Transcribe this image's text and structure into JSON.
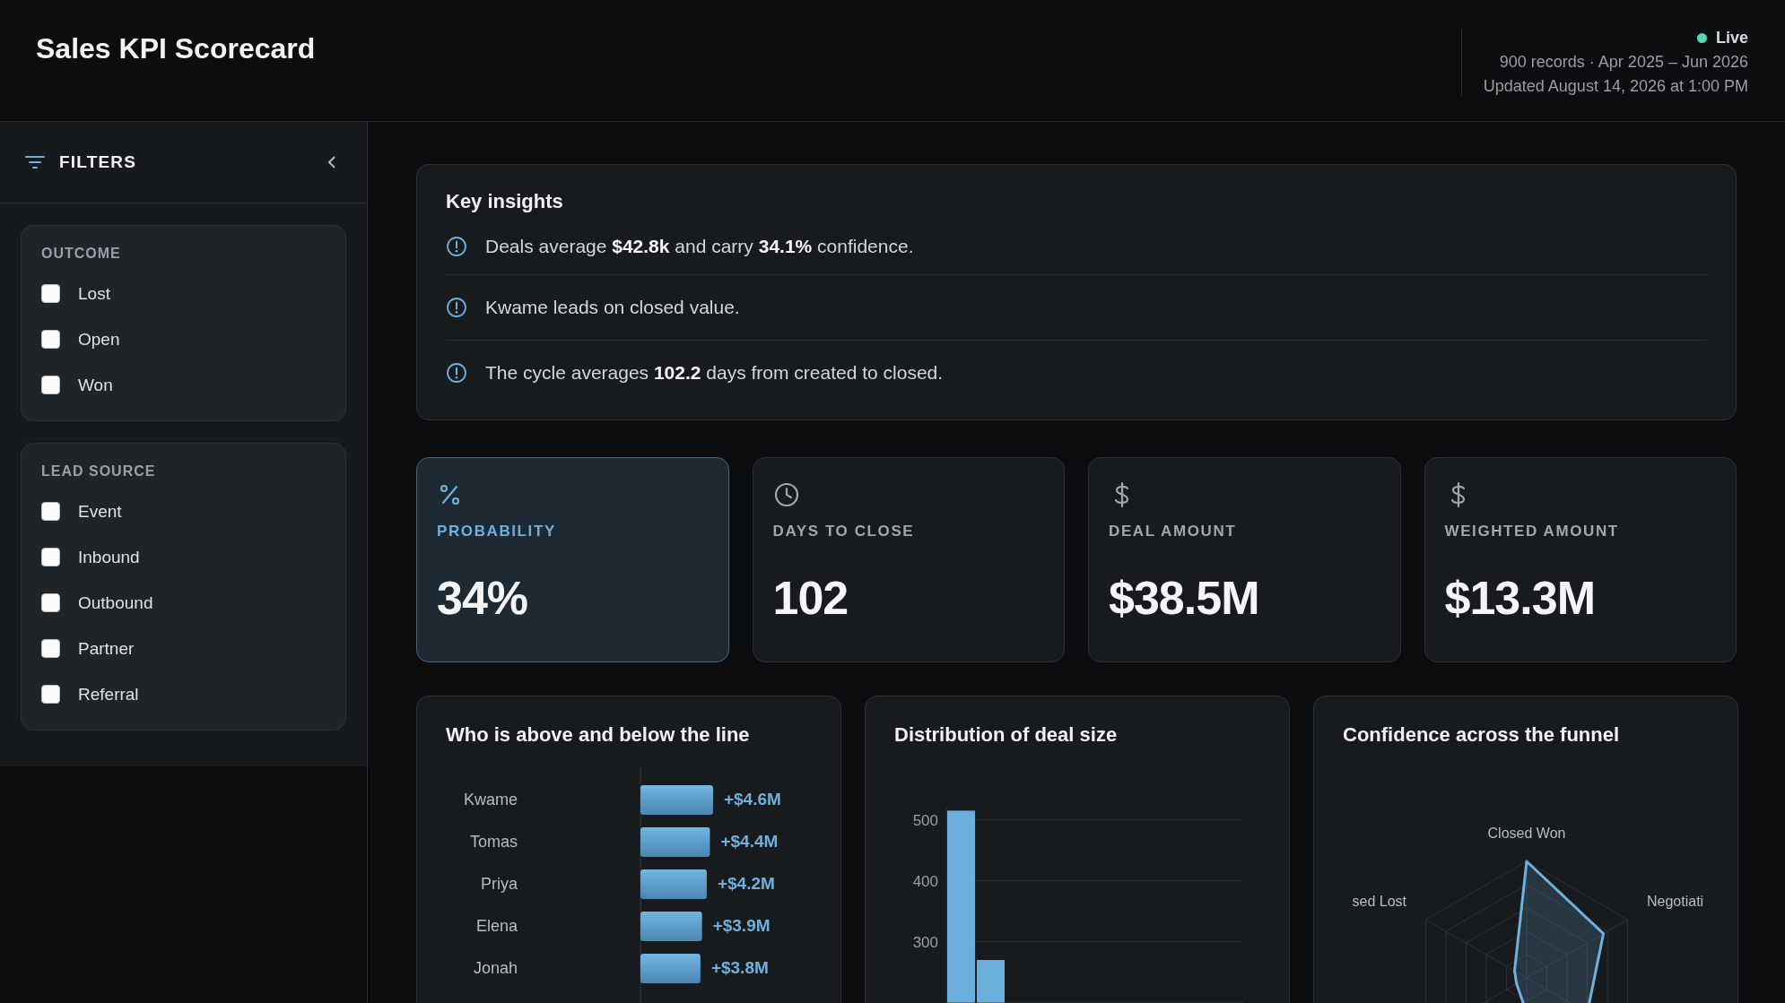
{
  "header": {
    "title": "Sales KPI Scorecard",
    "status": "Live",
    "summary": "900 records · Apr 2025 – Jun 2026",
    "updated": "Updated August 14, 2026 at 1:00 PM"
  },
  "sidebar": {
    "title": "FILTERS",
    "groups": [
      {
        "title": "OUTCOME",
        "options": [
          {
            "label": "Lost",
            "checked": false
          },
          {
            "label": "Open",
            "checked": false
          },
          {
            "label": "Won",
            "checked": false
          }
        ]
      },
      {
        "title": "LEAD SOURCE",
        "options": [
          {
            "label": "Event",
            "checked": false
          },
          {
            "label": "Inbound",
            "checked": false
          },
          {
            "label": "Outbound",
            "checked": false
          },
          {
            "label": "Partner",
            "checked": false
          },
          {
            "label": "Referral",
            "checked": false
          }
        ]
      }
    ]
  },
  "insights": {
    "title": "Key insights",
    "items": [
      "Deals average **$42.8k** and carry **34.1%** confidence.",
      "Kwame leads on closed value.",
      "The cycle averages **102.2** days from created to closed."
    ]
  },
  "kpis": [
    {
      "kind": "percent",
      "label": "PROBABILITY",
      "value": "34%",
      "selected": true
    },
    {
      "kind": "clock",
      "label": "DAYS TO CLOSE",
      "value": "102",
      "selected": false
    },
    {
      "kind": "dollar",
      "label": "DEAL AMOUNT",
      "value": "$38.5M",
      "selected": false
    },
    {
      "kind": "dollar",
      "label": "WEIGHTED AMOUNT",
      "value": "$13.3M",
      "selected": false
    }
  ],
  "charts": [
    {
      "title": "Who is above and below the line",
      "chart_data": {
        "type": "bar",
        "orientation": "horizontal",
        "categories": [
          "Kwame",
          "Tomas",
          "Priya",
          "Elena",
          "Jonah"
        ],
        "values": [
          4.6,
          4.4,
          4.2,
          3.9,
          3.8
        ],
        "value_labels": [
          "+$4.6M",
          "+$4.4M",
          "+$4.2M",
          "+$3.9M",
          "+$3.8M"
        ]
      }
    },
    {
      "title": "Distribution of deal size",
      "chart_data": {
        "type": "bar",
        "orientation": "vertical",
        "values": [
          515,
          270,
          null,
          null,
          null,
          null,
          null,
          null,
          null,
          null
        ],
        "ylim": [
          200,
          520
        ],
        "yticks": [
          300,
          400,
          500
        ],
        "grid": true
      }
    },
    {
      "kind": "radar",
      "title": "Confidence across the funnel",
      "axis_labels": [
        "Closed Won",
        "Negotiati",
        "sed Lost"
      ]
    }
  ]
}
